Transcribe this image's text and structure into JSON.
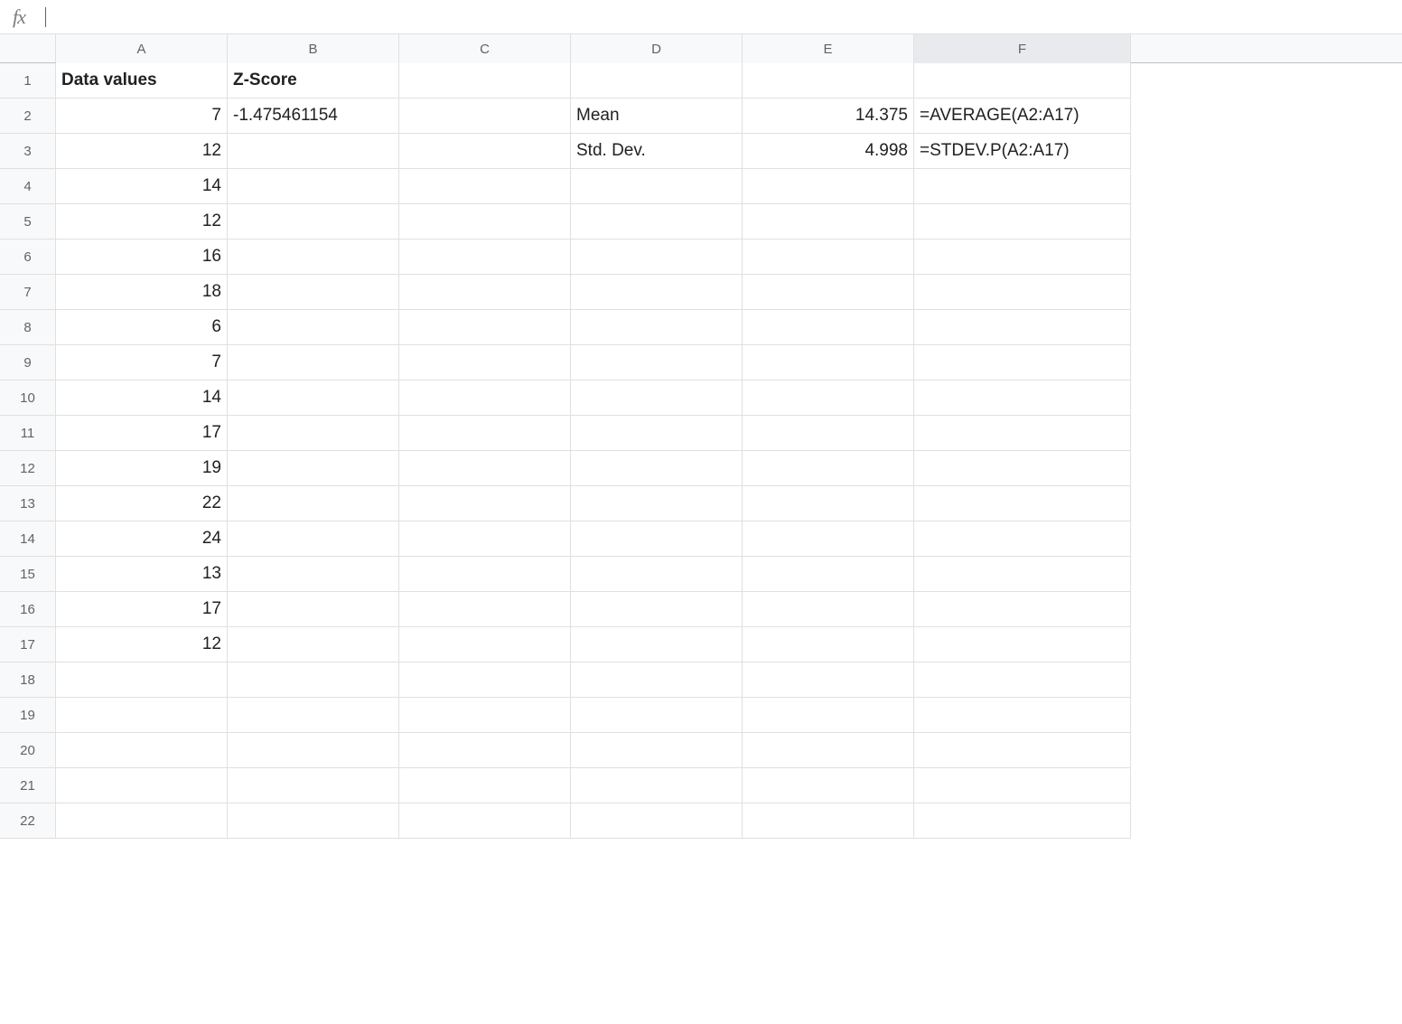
{
  "formula_bar": {
    "fx_label": "fx",
    "value": ""
  },
  "columns": [
    "A",
    "B",
    "C",
    "D",
    "E",
    "F"
  ],
  "rows": [
    1,
    2,
    3,
    4,
    5,
    6,
    7,
    8,
    9,
    10,
    11,
    12,
    13,
    14,
    15,
    16,
    17,
    18,
    19,
    20,
    21,
    22
  ],
  "selected_column": "F",
  "cells": {
    "A1": {
      "v": "Data values",
      "bold": true,
      "align": "left"
    },
    "B1": {
      "v": "Z-Score",
      "bold": true,
      "align": "left"
    },
    "A2": {
      "v": "7",
      "align": "right"
    },
    "B2": {
      "v": "-1.475461154",
      "align": "left"
    },
    "D2": {
      "v": "Mean",
      "align": "left"
    },
    "E2": {
      "v": "14.375",
      "align": "right"
    },
    "F2": {
      "v": "=AVERAGE(A2:A17)",
      "align": "left"
    },
    "A3": {
      "v": "12",
      "align": "right"
    },
    "D3": {
      "v": "Std. Dev.",
      "align": "left"
    },
    "E3": {
      "v": "4.998",
      "align": "right"
    },
    "F3": {
      "v": "=STDEV.P(A2:A17)",
      "align": "left"
    },
    "A4": {
      "v": "14",
      "align": "right"
    },
    "A5": {
      "v": "12",
      "align": "right"
    },
    "A6": {
      "v": "16",
      "align": "right"
    },
    "A7": {
      "v": "18",
      "align": "right"
    },
    "A8": {
      "v": "6",
      "align": "right"
    },
    "A9": {
      "v": "7",
      "align": "right"
    },
    "A10": {
      "v": "14",
      "align": "right"
    },
    "A11": {
      "v": "17",
      "align": "right"
    },
    "A12": {
      "v": "19",
      "align": "right"
    },
    "A13": {
      "v": "22",
      "align": "right"
    },
    "A14": {
      "v": "24",
      "align": "right"
    },
    "A15": {
      "v": "13",
      "align": "right"
    },
    "A16": {
      "v": "17",
      "align": "right"
    },
    "A17": {
      "v": "12",
      "align": "right"
    }
  }
}
